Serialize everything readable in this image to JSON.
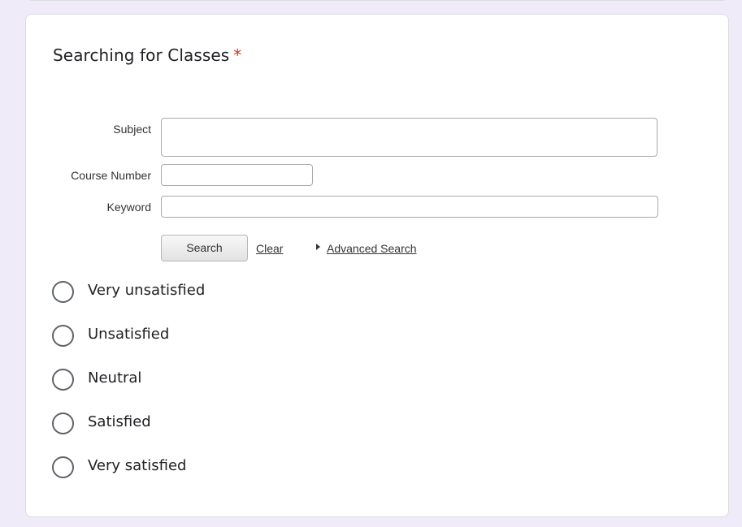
{
  "question": {
    "title": "Searching for Classes",
    "required_mark": "*"
  },
  "search_form": {
    "subject_label": "Subject",
    "course_number_label": "Course Number",
    "keyword_label": "Keyword",
    "search_button": "Search",
    "clear_link": "Clear",
    "advanced_search_link": "Advanced Search"
  },
  "options": [
    {
      "label": "Very unsatisfied"
    },
    {
      "label": "Unsatisfied"
    },
    {
      "label": "Neutral"
    },
    {
      "label": "Satisfied"
    },
    {
      "label": "Very satisfied"
    }
  ],
  "colors": {
    "background": "#f0ebf8",
    "card": "#ffffff",
    "required": "#d93025",
    "radio_border": "#5f6368"
  }
}
